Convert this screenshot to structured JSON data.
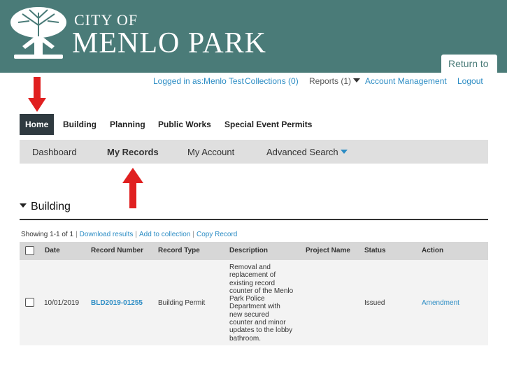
{
  "header": {
    "city_of": "CITY OF",
    "city_name": "MENLO PARK",
    "return_to": "Return to"
  },
  "top_links": {
    "logged_in": "Logged in as:Menlo Test",
    "collections": "Collections (0)",
    "reports": "Reports (1)",
    "account_management": "Account Management",
    "logout": "Logout"
  },
  "main_nav": {
    "home": "Home",
    "building": "Building",
    "planning": "Planning",
    "public_works": "Public Works",
    "special_event_permits": "Special Event Permits"
  },
  "sub_nav": {
    "dashboard": "Dashboard",
    "my_records": "My Records",
    "my_account": "My Account",
    "advanced_search": "Advanced Search"
  },
  "section": {
    "title": "Building",
    "showing": "Showing 1-1 of 1",
    "download": "Download results",
    "add_to_collection": "Add to collection",
    "copy_record": "Copy Record",
    "separator": "|"
  },
  "table": {
    "headers": {
      "date": "Date",
      "record_number": "Record Number",
      "record_type": "Record Type",
      "description": "Description",
      "project_name": "Project Name",
      "status": "Status",
      "action": "Action"
    },
    "rows": [
      {
        "date": "10/01/2019",
        "record_number": "BLD2019-01255",
        "record_type": "Building Permit",
        "description_lines": [
          "Removal and",
          "replacement of",
          "existing record",
          "counter of the Menlo",
          "Park Police",
          "Department with",
          "new secured",
          "counter and minor",
          "updates to the lobby",
          "bathroom."
        ],
        "project_name": "",
        "status": "Issued",
        "action": "Amendment"
      }
    ]
  },
  "colors": {
    "banner": "#4a7b78",
    "link": "#2b8cc4",
    "annotation_arrow": "#e02020",
    "home_tab": "#2f3a40"
  }
}
